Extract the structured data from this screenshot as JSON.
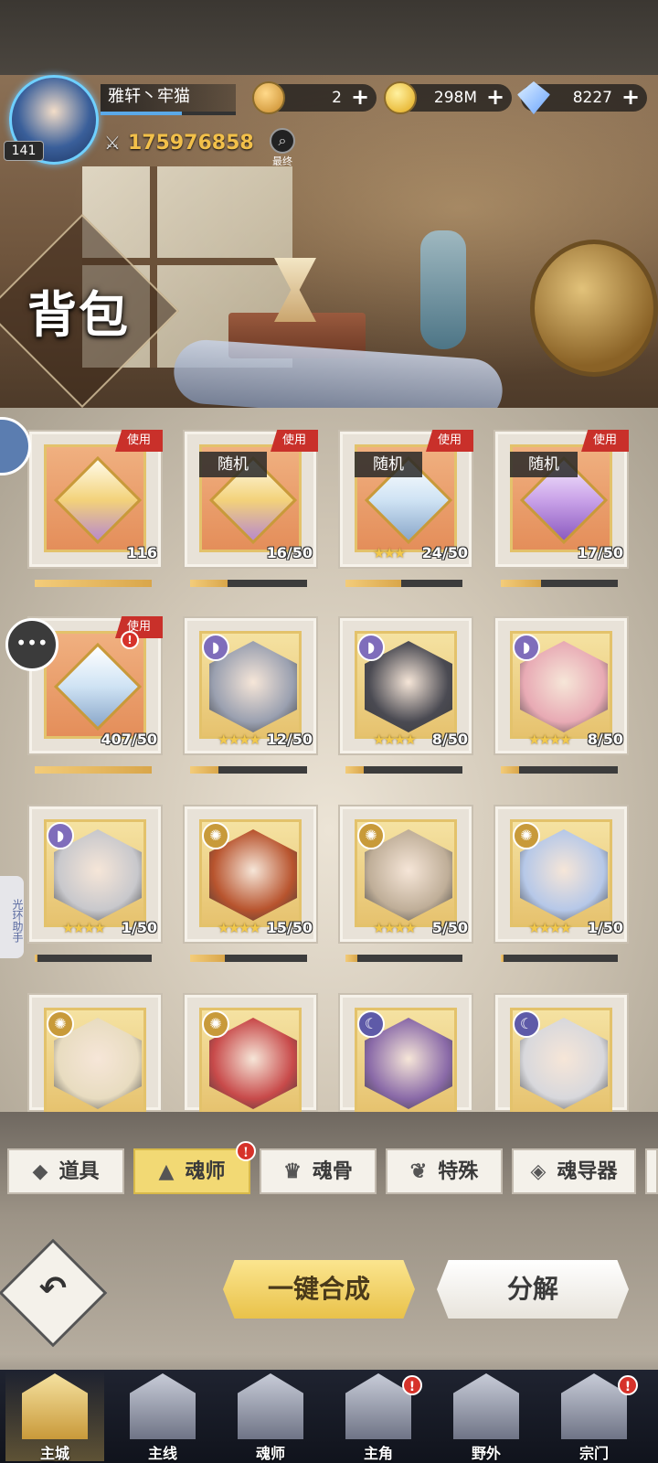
{
  "header": {
    "title": "背包",
    "player_name": "雅轩丶牢猫",
    "level": "141",
    "power": "175976858",
    "final_label": "最终",
    "currencies": [
      {
        "icon": "token-coin-icon",
        "amount": "2",
        "color": "#e0a84a"
      },
      {
        "icon": "gold-coin-icon",
        "amount": "298M",
        "color": "#f0c238"
      },
      {
        "icon": "diamond-icon",
        "amount": "8227",
        "color": "#8ab8ff"
      }
    ]
  },
  "items": [
    {
      "kind": "gem",
      "gem": "gold",
      "bg": "orange",
      "use": "使用",
      "random": "",
      "count": "116",
      "stars": 0,
      "progress": 1.0
    },
    {
      "kind": "gem",
      "gem": "gold",
      "bg": "orange",
      "use": "使用",
      "random": "随机",
      "count": "16/50",
      "stars": 0,
      "progress": 0.32
    },
    {
      "kind": "gem",
      "gem": "blue",
      "bg": "orange",
      "use": "使用",
      "random": "随机",
      "count": "24/50",
      "stars": 3,
      "progress": 0.48
    },
    {
      "kind": "gem",
      "gem": "purple",
      "bg": "orange",
      "use": "使用",
      "random": "随机",
      "count": "17/50",
      "stars": 0,
      "progress": 0.34
    },
    {
      "kind": "gem",
      "gem": "blue",
      "bg": "orange",
      "use": "使用",
      "random": "",
      "count": "407/50",
      "stars": 0,
      "progress": 1.0,
      "alert": true
    },
    {
      "kind": "hero",
      "elem": "vio",
      "bg": "gold",
      "count": "12/50",
      "stars": 4,
      "progress": 0.24,
      "portrait": "#9aa0b0"
    },
    {
      "kind": "hero",
      "elem": "vio",
      "bg": "gold",
      "count": "8/50",
      "stars": 4,
      "progress": 0.16,
      "portrait": "#4a4a52"
    },
    {
      "kind": "hero",
      "elem": "vio",
      "bg": "gold",
      "count": "8/50",
      "stars": 4,
      "progress": 0.16,
      "portrait": "#e8aab4"
    },
    {
      "kind": "hero",
      "elem": "vio",
      "bg": "gold",
      "count": "1/50",
      "stars": 4,
      "progress": 0.02,
      "portrait": "#c8c8cc"
    },
    {
      "kind": "hero",
      "elem": "sun",
      "bg": "gold",
      "count": "15/50",
      "stars": 4,
      "progress": 0.3,
      "portrait": "#b8542e"
    },
    {
      "kind": "hero",
      "elem": "sun",
      "bg": "gold",
      "count": "5/50",
      "stars": 4,
      "progress": 0.1,
      "portrait": "#bfae98"
    },
    {
      "kind": "hero",
      "elem": "sun",
      "bg": "gold",
      "count": "1/50",
      "stars": 4,
      "progress": 0.02,
      "portrait": "#b6c8e8"
    },
    {
      "kind": "hero",
      "elem": "sun",
      "bg": "gold",
      "count": "",
      "stars": 0,
      "progress": 0,
      "portrait": "#e8dcc0"
    },
    {
      "kind": "hero",
      "elem": "sun",
      "bg": "gold",
      "count": "",
      "stars": 0,
      "progress": 0,
      "portrait": "#c84a4a"
    },
    {
      "kind": "hero",
      "elem": "moon",
      "bg": "gold",
      "count": "",
      "stars": 0,
      "progress": 0,
      "portrait": "#8a6aa8"
    },
    {
      "kind": "hero",
      "elem": "moon",
      "bg": "gold",
      "count": "",
      "stars": 0,
      "progress": 0,
      "portrait": "#d8d8dc"
    }
  ],
  "side": {
    "helper_label": "光环助手"
  },
  "tabs": [
    {
      "label": "道具",
      "icon": "box-icon",
      "active": false
    },
    {
      "label": "魂师",
      "icon": "soul-master-icon",
      "active": true,
      "alert": "!"
    },
    {
      "label": "魂骨",
      "icon": "soul-bone-icon",
      "active": false
    },
    {
      "label": "特殊",
      "icon": "wing-icon",
      "active": false
    },
    {
      "label": "魂导器",
      "icon": "soul-device-icon",
      "active": false
    }
  ],
  "actions": {
    "compose_all": "一键合成",
    "decompose": "分解"
  },
  "nav": [
    {
      "label": "主城",
      "active": true,
      "alert": ""
    },
    {
      "label": "主线",
      "active": false,
      "alert": ""
    },
    {
      "label": "魂师",
      "active": false,
      "alert": ""
    },
    {
      "label": "主角",
      "active": false,
      "alert": "!"
    },
    {
      "label": "野外",
      "active": false,
      "alert": ""
    },
    {
      "label": "宗门",
      "active": false,
      "alert": "!"
    }
  ]
}
